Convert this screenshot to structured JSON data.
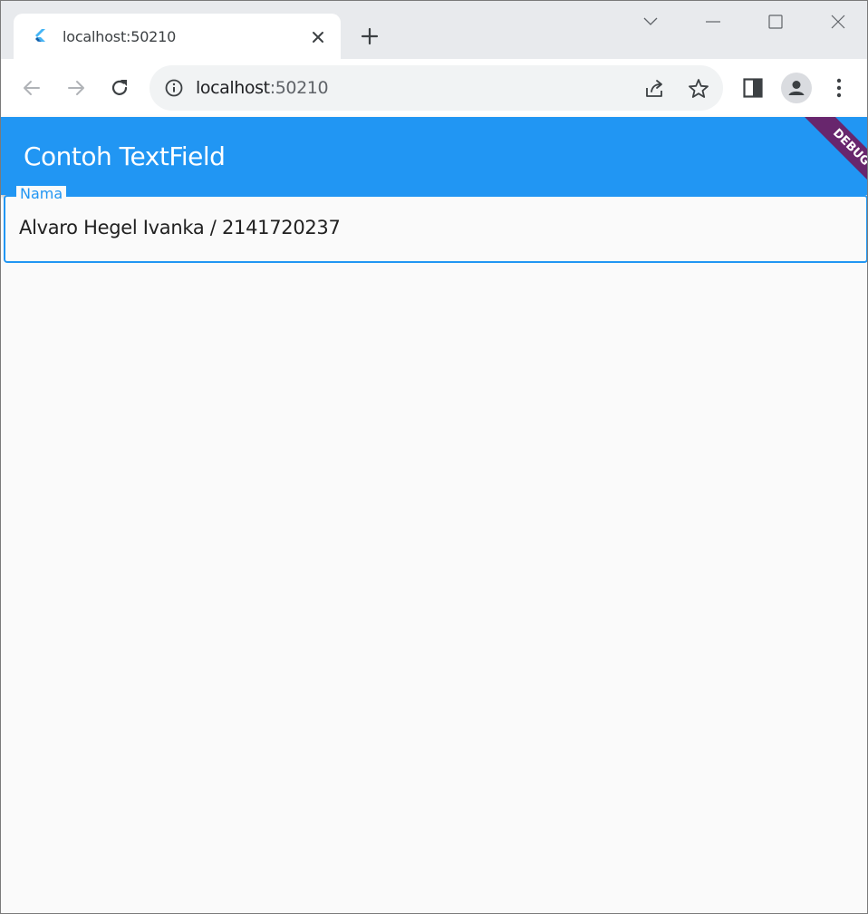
{
  "browser": {
    "tab": {
      "title": "localhost:50210",
      "favicon_icon": "flutter-logo-icon",
      "close_icon": "close-icon"
    },
    "new_tab_icon": "plus-icon",
    "window_controls": [
      "chevron-down-icon",
      "minimize-icon",
      "maximize-icon",
      "close-icon"
    ],
    "toolbar": {
      "back_icon": "arrow-left-icon",
      "forward_icon": "arrow-right-icon",
      "reload_icon": "reload-icon",
      "site_info_icon": "info-icon",
      "url_host": "localhost",
      "url_port": ":50210",
      "share_icon": "share-icon",
      "bookmark_icon": "star-icon",
      "side_panel_icon": "side-panel-icon",
      "profile_icon": "profile-icon",
      "menu_icon": "kebab-menu-icon"
    }
  },
  "app": {
    "appbar_title": "Contoh TextField",
    "debug_banner": "DEBUG",
    "text_field": {
      "label": "Nama",
      "value": "Alvaro Hegel Ivanka / 2141720237"
    },
    "colors": {
      "primary": "#2196f3",
      "background": "#fafafa",
      "debug_banner": "#80003f"
    }
  }
}
